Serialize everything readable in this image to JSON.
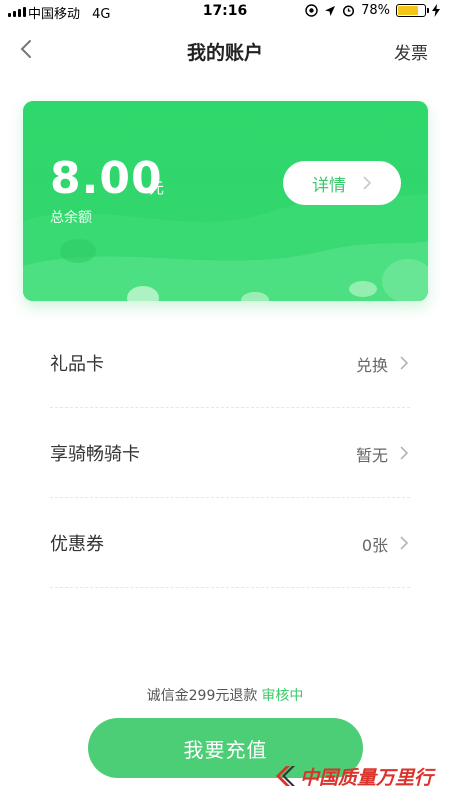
{
  "status_bar": {
    "carrier": "中国移动",
    "network": "4G",
    "time": "17:16",
    "battery": "78%",
    "battery_level": 0.78,
    "icons": [
      "signal-icon",
      "at-icon",
      "location-icon",
      "alarm-icon",
      "battery-icon",
      "charging-icon"
    ]
  },
  "nav": {
    "title": "我的账户",
    "invoice": "发票",
    "back_icon": "chevron-left-icon"
  },
  "card": {
    "amount": "8.00",
    "unit": "元",
    "label": "总余额",
    "detail_button": "详情",
    "accent": "#2fd86c"
  },
  "list": [
    {
      "name": "礼品卡",
      "value": "兑换"
    },
    {
      "name": "享骑畅骑卡",
      "value": "暂无"
    },
    {
      "name": "优惠券",
      "value": "0张"
    }
  ],
  "footer": {
    "deposit": "诚信金299元退款",
    "deposit_status": "审核中",
    "recharge_button": "我要充值",
    "brand_green": "#4cce76"
  },
  "watermark": {
    "text": "中国质量万里行"
  }
}
